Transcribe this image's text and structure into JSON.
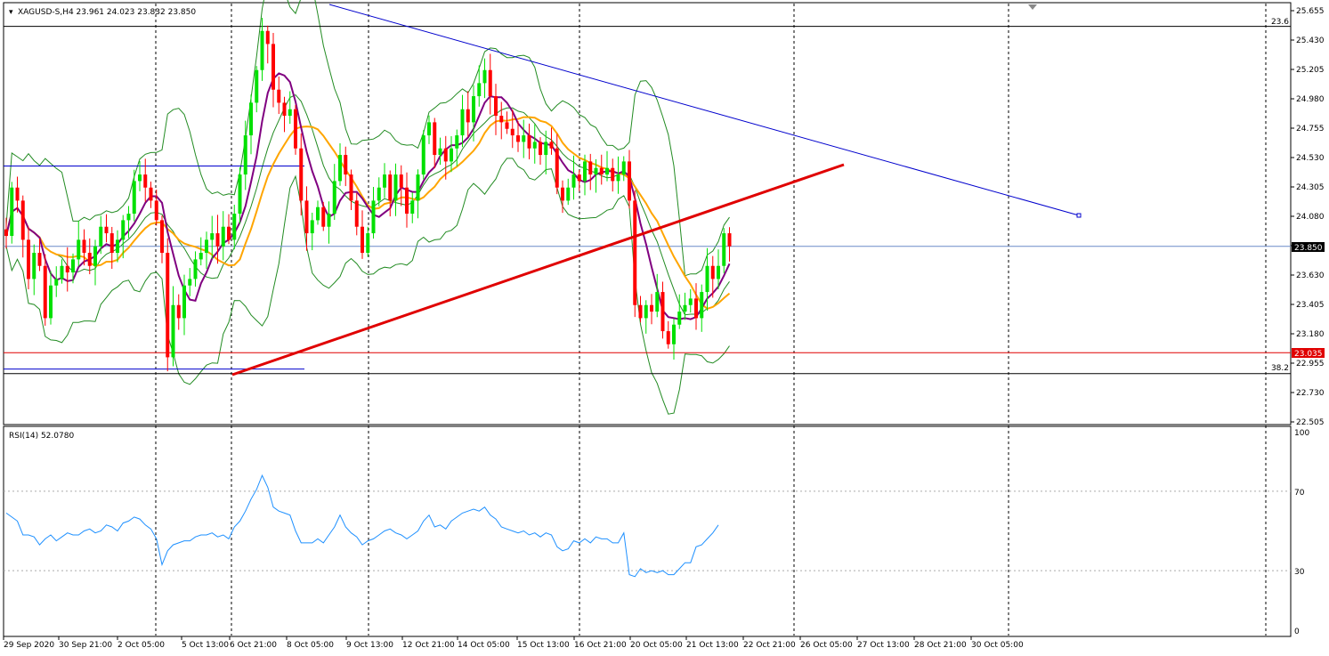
{
  "header": {
    "symbol_line": "XAGUSD-S,H4  23.961 24.023 23.832 23.850"
  },
  "rsi_panel": {
    "label": "RSI(14) 52.0780"
  },
  "price_badges": {
    "current": "23.850",
    "support": "23.035"
  },
  "fib_labels": {
    "top": "23.6",
    "bottom": "38.2"
  },
  "colors": {
    "bull_candle": "#00e000",
    "bear_candle": "#ff0000",
    "sma_fast": "#800080",
    "sma_slow": "#ffa500",
    "bollinger": "#228b22",
    "trendline_down": "#0000cd",
    "trendline_up": "#e00000",
    "rsi_line": "#1e90ff",
    "support_line": "#e00000"
  },
  "chart_data": {
    "type": "candlestick",
    "symbol": "XAGUSD-S",
    "timeframe": "H4",
    "ohlc_last": {
      "open": 23.961,
      "high": 24.023,
      "low": 23.832,
      "close": 23.85
    },
    "price_axis": {
      "range": [
        22.505,
        25.655
      ],
      "ticks": [
        "25.655",
        "25.430",
        "25.205",
        "24.980",
        "24.755",
        "24.530",
        "24.305",
        "24.080",
        "23.855",
        "23.630",
        "23.405",
        "23.180",
        "22.955",
        "22.730",
        "22.505"
      ]
    },
    "time_axis": {
      "ticks": [
        "29 Sep 2020",
        "30 Sep 21:00",
        "2 Oct 05:00",
        "5 Oct 13:00",
        "6 Oct 21:00",
        "8 Oct 05:00",
        "9 Oct 13:00",
        "12 Oct 21:00",
        "14 Oct 05:00",
        "15 Oct 13:00",
        "16 Oct 21:00",
        "20 Oct 05:00",
        "21 Oct 13:00",
        "22 Oct 21:00",
        "26 Oct 05:00",
        "27 Oct 13:00",
        "28 Oct 21:00",
        "30 Oct 05:00"
      ]
    },
    "horizontal_lines": [
      {
        "price": 25.535,
        "label": "23.6"
      },
      {
        "price": 22.875,
        "label": "38.2"
      },
      {
        "price": 23.035
      },
      {
        "price": 23.85
      }
    ],
    "closes": [
      23.93,
      24.3,
      24.2,
      23.9,
      23.6,
      23.8,
      23.7,
      23.3,
      23.55,
      23.6,
      23.7,
      23.65,
      23.75,
      23.9,
      23.8,
      23.7,
      23.85,
      24.0,
      23.95,
      23.8,
      23.9,
      24.05,
      24.1,
      24.35,
      24.4,
      24.3,
      24.2,
      24.05,
      23.8,
      23.0,
      23.4,
      23.3,
      23.55,
      23.6,
      23.75,
      23.8,
      23.9,
      23.95,
      23.85,
      24.0,
      23.9,
      24.1,
      24.4,
      24.7,
      24.95,
      25.2,
      25.5,
      25.4,
      25.05,
      24.95,
      24.85,
      24.9,
      24.6,
      24.2,
      23.95,
      24.05,
      24.15,
      24.0,
      24.1,
      24.35,
      24.55,
      24.4,
      24.2,
      24.0,
      23.8,
      23.95,
      24.2,
      24.3,
      24.4,
      24.2,
      24.4,
      24.3,
      24.1,
      24.2,
      24.4,
      24.7,
      24.8,
      24.55,
      24.6,
      24.5,
      24.6,
      24.7,
      24.9,
      24.8,
      25.0,
      25.1,
      25.2,
      25.0,
      24.85,
      24.8,
      24.75,
      24.7,
      24.65,
      24.7,
      24.6,
      24.65,
      24.55,
      24.65,
      24.6,
      24.3,
      24.2,
      24.3,
      24.4,
      24.35,
      24.5,
      24.4,
      24.45,
      24.4,
      24.45,
      24.35,
      24.4,
      24.5,
      24.2,
      23.4,
      23.3,
      23.4,
      23.35,
      23.5,
      23.2,
      23.1,
      23.25,
      23.35,
      23.4,
      23.45,
      23.3,
      23.5,
      23.7,
      23.6,
      23.7,
      23.95,
      23.85
    ],
    "rsi": {
      "period": 14,
      "value": 52.078,
      "levels": [
        30,
        70
      ],
      "axis": [
        "100",
        "70",
        "30",
        "0"
      ],
      "values": [
        59,
        57,
        55,
        48,
        48,
        47,
        43,
        46,
        48,
        45,
        47,
        49,
        48,
        48,
        50,
        51,
        49,
        50,
        53,
        52,
        50,
        54,
        55,
        57,
        56,
        53,
        51,
        46,
        33,
        40,
        43,
        44,
        45,
        45,
        47,
        48,
        48,
        49,
        47,
        48,
        46,
        52,
        55,
        60,
        66,
        71,
        78,
        72,
        62,
        60,
        59,
        58,
        50,
        44,
        44,
        44,
        46,
        44,
        48,
        52,
        58,
        52,
        49,
        47,
        43,
        45,
        46,
        48,
        50,
        51,
        49,
        48,
        46,
        48,
        50,
        55,
        58,
        52,
        53,
        51,
        55,
        57,
        59,
        60,
        61,
        60,
        62,
        58,
        56,
        52,
        51,
        50,
        49,
        50,
        48,
        49,
        47,
        49,
        48,
        42,
        40,
        41,
        45,
        44,
        46,
        44,
        47,
        46,
        46,
        44,
        44,
        49,
        28,
        27,
        31,
        29,
        30,
        29,
        30,
        28,
        28,
        31,
        34,
        34,
        42,
        43,
        46,
        49,
        53
      ]
    },
    "trendlines": [
      {
        "name": "descending",
        "from": [
          "4 Oct 21:00",
          25.7
        ],
        "to": [
          "31 Oct 05:00",
          24.1
        ]
      },
      {
        "name": "ascending",
        "from": [
          "6 Oct 21:00",
          22.85
        ],
        "to": [
          "27 Oct 09:00",
          24.5
        ]
      }
    ],
    "indicators": [
      "Bollinger Bands",
      "fast moving average",
      "slow moving average",
      "RSI(14)"
    ],
    "grid": "vertical dashed separators"
  }
}
